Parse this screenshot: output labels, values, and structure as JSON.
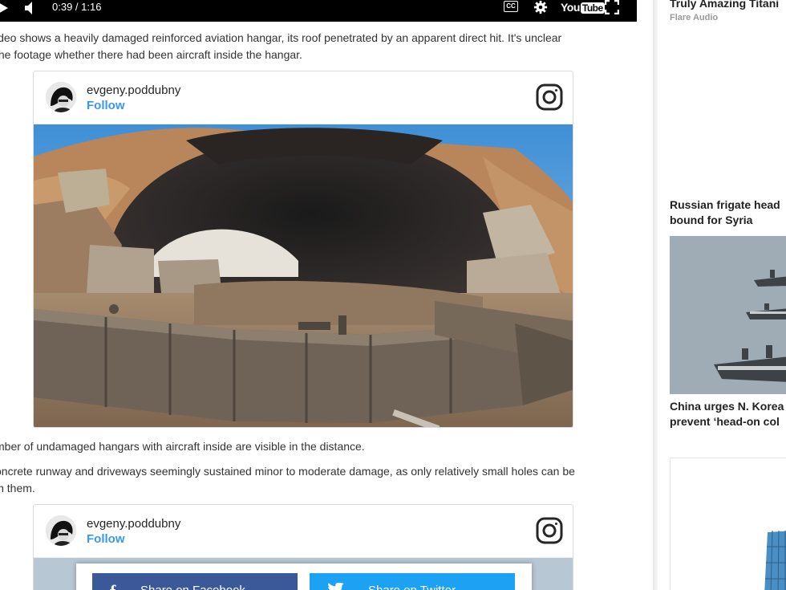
{
  "player": {
    "time": "0:39 / 1:16",
    "cc_label": "CC",
    "youtube_you": "You",
    "youtube_tube": "Tube"
  },
  "article": {
    "paragraph1": "ideo shows a heavily damaged reinforced aviation hangar, its roof penetrated by an apparent direct hit. It's unclear the footage whether there had been aircraft inside the hangar.",
    "paragraph1_line1": "ideo shows a heavily damaged reinforced aviation hangar, its roof penetrated by an apparent direct hit. It's unclear",
    "paragraph1_line2": "the footage whether there had been aircraft inside the hangar.",
    "paragraph2": "mber of undamaged hangars with aircraft inside are visible in the distance.",
    "paragraph3_line1": "oncrete runway and driveways seemingly sustained minor to moderate damage, as only relatively small holes can be",
    "paragraph3_line2": "in them."
  },
  "embeds": [
    {
      "username": "evgeny.poddubny",
      "follow": "Follow"
    },
    {
      "username": "evgeny.poddubny",
      "follow": "Follow",
      "share_facebook": "Share on Facebook",
      "share_twitter": "Share on Twitter"
    }
  ],
  "sidebar": {
    "item1_title": "Truly Amazing Titani",
    "item1_source": "Flare Audio",
    "item2_title_line1": "Russian frigate head",
    "item2_title_line2": "bound for Syria",
    "item3_title_line1": "China urges N. Korea",
    "item3_title_line2": "prevent ‘head-on col"
  },
  "colors": {
    "instagram_follow": "#3897f0",
    "facebook": "#3b5998",
    "twitter": "#1da1f2"
  }
}
